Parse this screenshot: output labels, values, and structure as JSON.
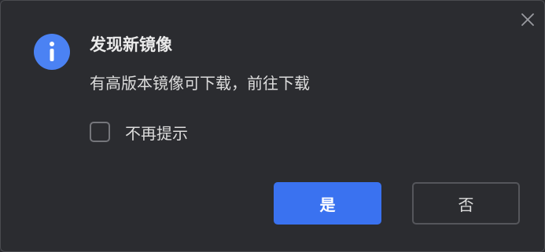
{
  "dialog": {
    "title": "发现新镜像",
    "message": "有高版本镜像可下载，前往下载",
    "checkbox_label": "不再提示",
    "checkbox_checked": false,
    "confirm_label": "是",
    "cancel_label": "否",
    "icons": {
      "info": "info-icon",
      "close": "close-icon"
    },
    "colors": {
      "background": "#2b2c30",
      "accent": "#3a72f0",
      "info_icon": "#4b82f3"
    }
  }
}
